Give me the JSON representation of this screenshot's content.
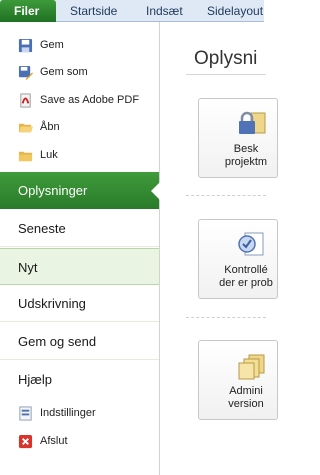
{
  "ribbon": {
    "file_tab": "Filer",
    "tabs": [
      "Startside",
      "Indsæt",
      "Sidelayout"
    ]
  },
  "backstage": {
    "commands_top": [
      {
        "label": "Gem",
        "icon": "save-icon"
      },
      {
        "label": "Gem som",
        "icon": "save-as-icon"
      },
      {
        "label": "Save as Adobe PDF",
        "icon": "pdf-icon"
      },
      {
        "label": "Åbn",
        "icon": "open-folder-icon"
      },
      {
        "label": "Luk",
        "icon": "close-folder-icon"
      }
    ],
    "tabs": [
      {
        "label": "Oplysninger",
        "state": "active"
      },
      {
        "label": "Seneste",
        "state": "normal"
      },
      {
        "label": "Nyt",
        "state": "hover"
      },
      {
        "label": "Udskrivning",
        "state": "normal"
      },
      {
        "label": "Gem og send",
        "state": "normal"
      },
      {
        "label": "Hjælp",
        "state": "normal"
      }
    ],
    "commands_bottom": [
      {
        "label": "Indstillinger",
        "icon": "options-icon"
      },
      {
        "label": "Afslut",
        "icon": "exit-icon"
      }
    ]
  },
  "content": {
    "heading": "Oplysni",
    "cards": [
      {
        "line1": "Besk",
        "line2": "projektm",
        "icon": "lock-icon"
      },
      {
        "line1": "Kontrollé",
        "line2": "der er prob",
        "icon": "checklist-icon"
      },
      {
        "line1": "Admini",
        "line2": "version",
        "icon": "versions-icon"
      }
    ]
  },
  "colors": {
    "file_green": "#2a7b2a",
    "ribbon_bg": "#dfe9f5",
    "hover_green": "#e9f4e3"
  }
}
